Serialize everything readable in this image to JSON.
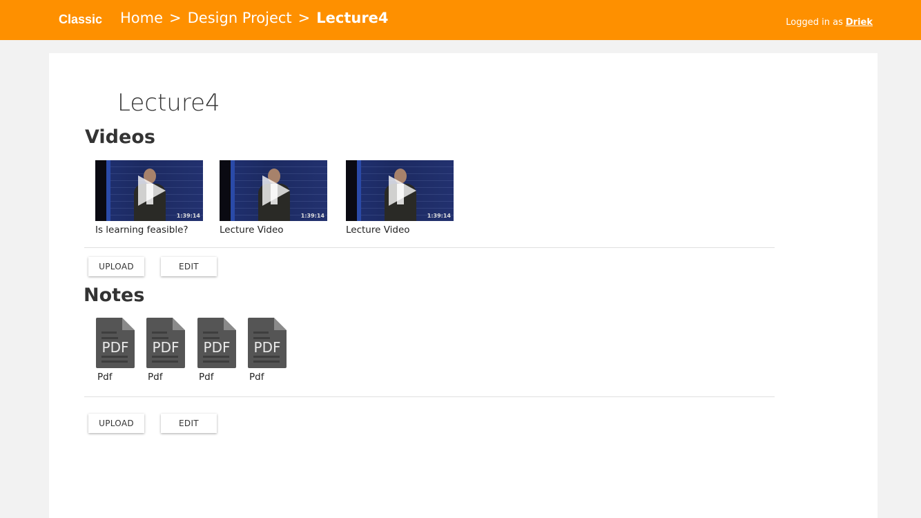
{
  "header": {
    "brand": "Classic",
    "breadcrumb": [
      "Home",
      "Design Project",
      "Lecture4"
    ],
    "separator": ">",
    "logged_in_label": "Logged in as",
    "username": "Driek"
  },
  "page": {
    "title": "Lecture4"
  },
  "videos": {
    "heading": "Videos",
    "items": [
      {
        "title": "Is learning feasible?",
        "duration": "1:39:14"
      },
      {
        "title": "Lecture Video",
        "duration": "1:39:14"
      },
      {
        "title": "Lecture Video",
        "duration": "1:39:14"
      }
    ],
    "upload_label": "UPLOAD",
    "edit_label": "EDIT"
  },
  "notes": {
    "heading": "Notes",
    "items": [
      {
        "name": "Pdf",
        "icon_label": "PDF"
      },
      {
        "name": "Pdf",
        "icon_label": "PDF"
      },
      {
        "name": "Pdf",
        "icon_label": "PDF"
      },
      {
        "name": "Pdf",
        "icon_label": "PDF"
      }
    ],
    "upload_label": "UPLOAD",
    "edit_label": "EDIT"
  },
  "colors": {
    "header_bg": "#fe9000",
    "page_bg": "#f2f2f2",
    "card_bg": "#ffffff"
  }
}
